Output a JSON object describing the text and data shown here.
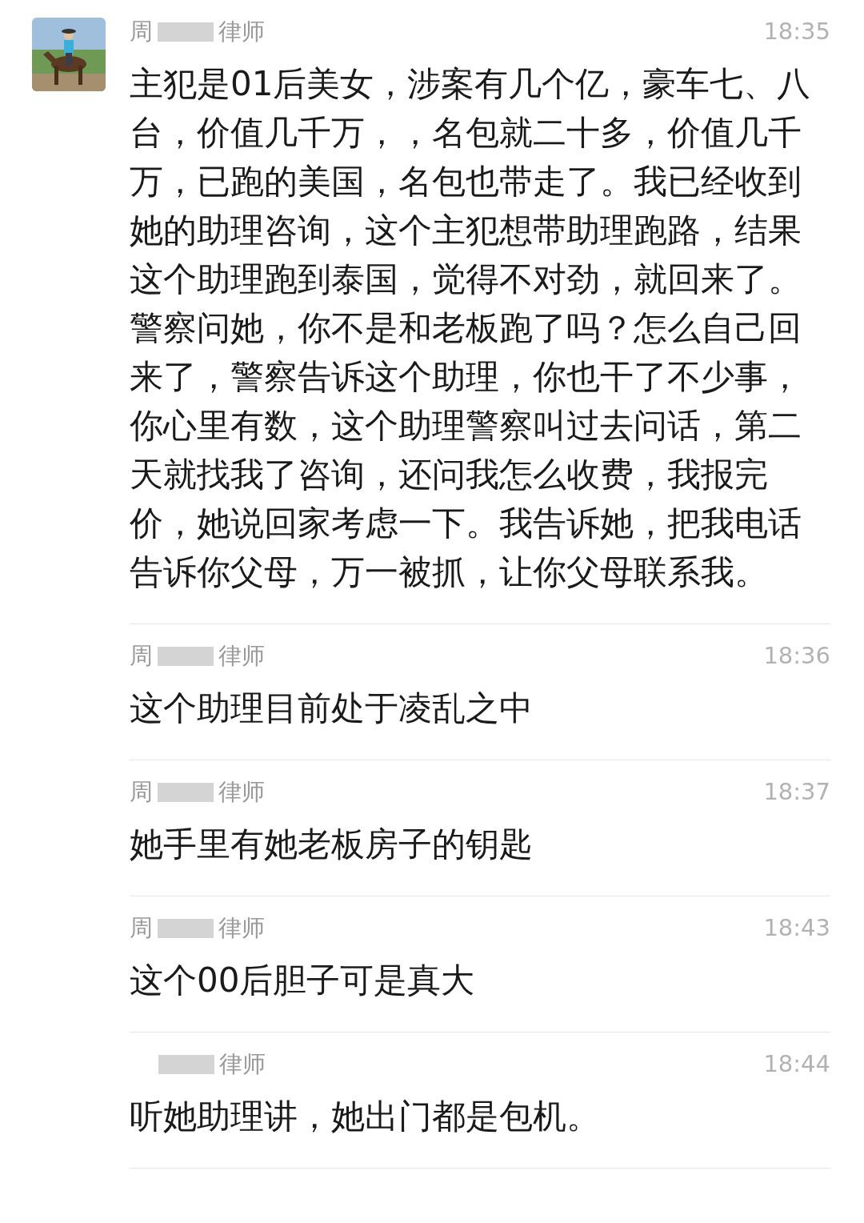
{
  "messages": [
    {
      "name_start": "周",
      "name_end": "律师",
      "time": "18:35",
      "text": "主犯是01后美女，涉案有几个亿，豪车七、八台，价值几千万，，名包就二十多，价值几千万，已跑的美国，名包也带走了。我已经收到她的助理咨询，这个主犯想带助理跑路，结果这个助理跑到泰国，觉得不对劲，就回来了。警察问她，你不是和老板跑了吗？怎么自己回来了，警察告诉这个助理，你也干了不少事，你心里有数，这个助理警察叫过去问话，第二天就找我了咨询，还问我怎么收费，我报完价，她说回家考虑一下。我告诉她，把我电话告诉你父母，万一被抓，让你父母联系我。"
    },
    {
      "name_start": "周",
      "name_end": "律师",
      "time": "18:36",
      "text": "这个助理目前处于凌乱之中"
    },
    {
      "name_start": "周",
      "name_end": "律师",
      "time": "18:37",
      "text": "她手里有她老板房子的钥匙"
    },
    {
      "name_start": "周",
      "name_end": "律师",
      "time": "18:43",
      "text": "这个00后胆子可是真大"
    },
    {
      "name_end": "律师",
      "time": "18:44",
      "text": "听她助理讲，她出门都是包机。"
    }
  ]
}
